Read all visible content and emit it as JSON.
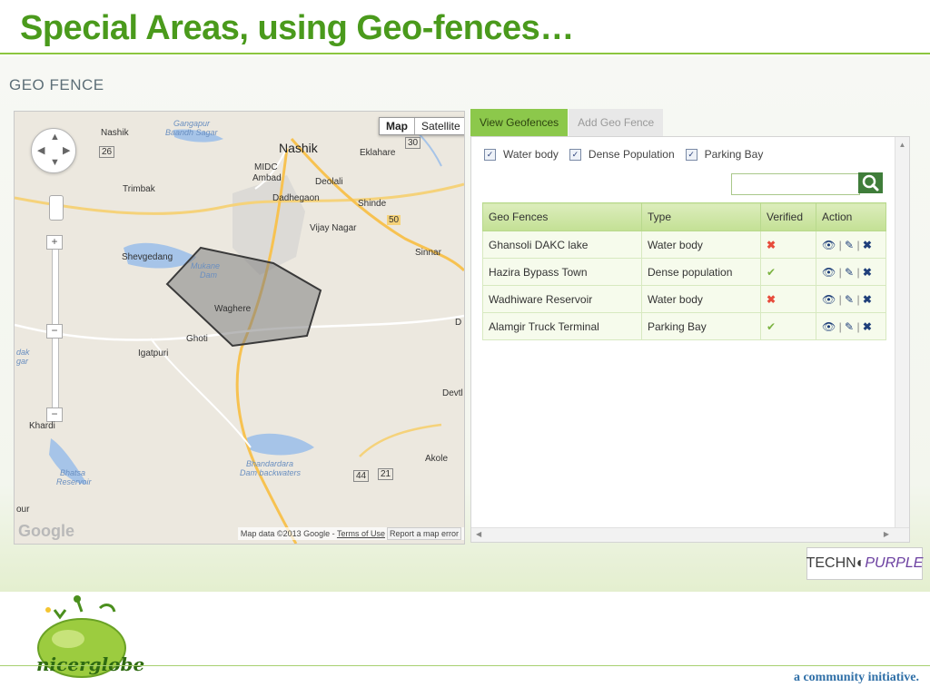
{
  "slide": {
    "title": "Special Areas, using Geo-fences…",
    "tagline": "a community initiative."
  },
  "panel": {
    "heading": "GEO FENCE"
  },
  "map": {
    "type_buttons": [
      "Map",
      "Satellite"
    ],
    "labels": {
      "nashik_small": "Nashik",
      "gangapur": "Gangapur",
      "baandh": "Baandh Sagar",
      "nashik": "Nashik",
      "eklahare": "Eklahare",
      "midc": "MIDC",
      "ambad": "Ambad",
      "deolali": "Deolali",
      "dadhegaon": "Dadhegaon",
      "trimbak": "Trimbak",
      "shinde": "Shinde",
      "vijay_nagar": "Vijay Nagar",
      "shevgedang": "Shevgedang",
      "sinnar": "Sinnar",
      "mukane": "Mukane",
      "dam": "Dam",
      "waghere": "Waghere",
      "ghoti": "Ghoti",
      "igatpuri": "Igatpuri",
      "d_right": "D",
      "devtl": "Devtl",
      "dak": "dak",
      "gar": "gar",
      "khardi": "Khardi",
      "akole": "Akole",
      "bhandardara": "Bhandardara",
      "dam_backwaters": "Dam backwaters",
      "bhatsa": "Bhatsa",
      "reservoir": "Reservoir",
      "our": "our",
      "shield_30": "30",
      "shield_26": "26",
      "shield_50": "50",
      "shield_44": "44",
      "shield_21": "21"
    },
    "logo": "Google",
    "attribution": {
      "data": "Map data ©2013 Google - ",
      "terms": "Terms of Use",
      "report": "Report a map error"
    },
    "geofence_color": "#7f7f7f"
  },
  "tabs": [
    {
      "label": "View Geofences",
      "active": true
    },
    {
      "label": "Add Geo Fence",
      "active": false
    }
  ],
  "filters": [
    {
      "label": "Water body",
      "checked": true
    },
    {
      "label": "Dense Population",
      "checked": true
    },
    {
      "label": "Parking Bay",
      "checked": true
    }
  ],
  "search": {
    "placeholder": ""
  },
  "table": {
    "headers": [
      "Geo Fences",
      "Type",
      "Verified",
      "Action"
    ],
    "rows": [
      {
        "name": "Ghansoli DAKC lake",
        "type": "Water body",
        "verified": "✖"
      },
      {
        "name": "Hazira Bypass Town",
        "type": "Dense population",
        "verified": "✔"
      },
      {
        "name": "Wadhiware Reservoir",
        "type": "Water body",
        "verified": "✖"
      },
      {
        "name": "Alamgir Truck Terminal",
        "type": "Parking Bay",
        "verified": "✔"
      }
    ],
    "actions": {
      "view": "👁",
      "sep": "|",
      "edit": "✎",
      "delete": "✖"
    }
  },
  "colors": {
    "accent_green": "#8cc84b",
    "title_green": "#4a9a1c",
    "verified_yes": "#7cb342",
    "verified_no": "#e74c3c",
    "delete": "#1f3f7a"
  },
  "logos": {
    "techno": "TECHN",
    "purple": "PURPLE",
    "nicerglobe": "nicerglobe"
  }
}
